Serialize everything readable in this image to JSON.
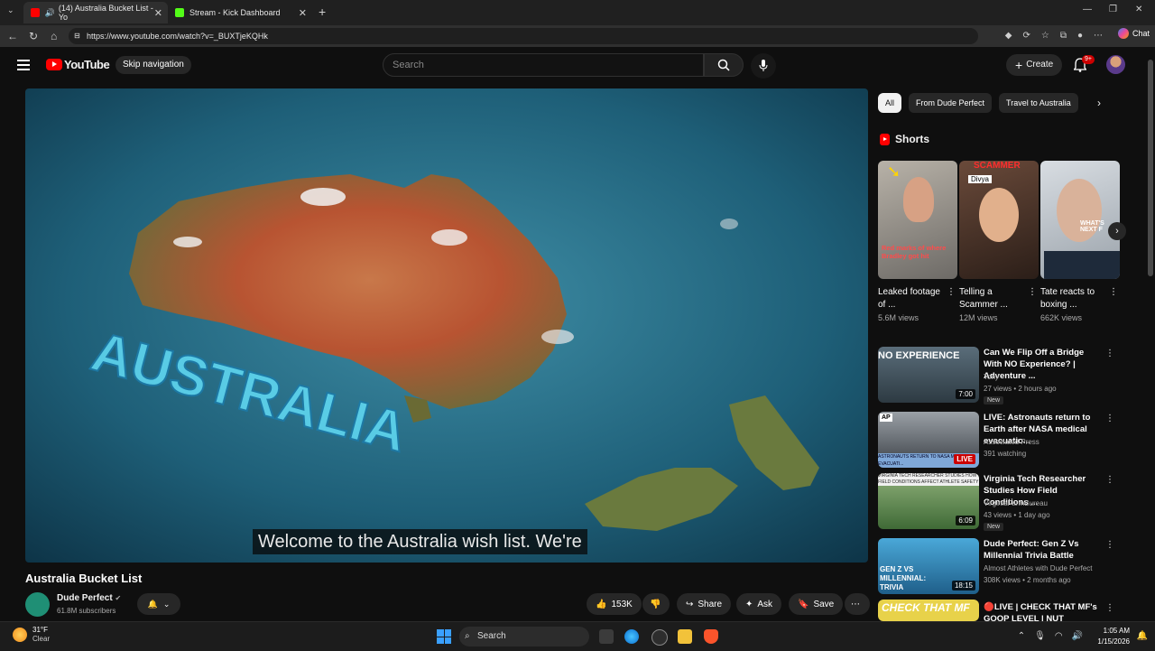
{
  "browser": {
    "tabs": [
      {
        "title": "(14) Australia Bucket List - Yo",
        "active": true
      },
      {
        "title": "Stream - Kick Dashboard",
        "active": false
      }
    ],
    "url": "https://www.youtube.com/watch?v=_BUXTjeKQHk",
    "chat_label": "Chat"
  },
  "header": {
    "logo_text": "YouTube",
    "skip_nav": "Skip navigation",
    "search_placeholder": "Search",
    "create_label": "Create",
    "notif_count": "9+"
  },
  "video": {
    "caption": "Welcome to the Australia wish list. We're",
    "overlay_text": "AUSTRALIA",
    "title": "Australia Bucket List",
    "channel": "Dude Perfect",
    "subscribers": "61.8M subscribers",
    "likes": "153K",
    "share_label": "Share",
    "ask_label": "Ask",
    "save_label": "Save"
  },
  "chips": [
    "All",
    "From Dude Perfect",
    "Travel to Australia"
  ],
  "shorts": {
    "heading": "Shorts",
    "items": [
      {
        "title": "Leaked footage of ...",
        "views": "5.6M views",
        "thumb_text": "Red marks of where Bradley got hit"
      },
      {
        "title": "Telling a Scammer ...",
        "views": "12M views",
        "thumb_text": "SCAMMER",
        "thumb_tag": "Divya"
      },
      {
        "title": "Tate reacts to boxing ...",
        "views": "662K views",
        "thumb_text": "WHAT'S NEXT F"
      }
    ]
  },
  "recommended": [
    {
      "title": "Can We Flip Off a Bridge With NO Experience? | Adventure ...",
      "channel": "Tony",
      "meta": "27 views • 2 hours ago",
      "badge": "New",
      "duration": "7:00",
      "thumb_text": "NO EXPERIENCE"
    },
    {
      "title": "LIVE: Astronauts return to Earth after NASA medical evacuatio...",
      "channel": "Associated Press",
      "meta": "391 watching",
      "badge": "",
      "duration": "LIVE",
      "thumb_text": "ASTRONAUTS RETURN TO NASA MEDICAL EVACUATI..."
    },
    {
      "title": "Virginia Tech Researcher Studies How Field Conditions ...",
      "channel": "VirginiaFarmBureau",
      "meta": "43 views • 1 day ago",
      "badge": "New",
      "duration": "6:09",
      "thumb_text": "VIRGINIA TECH RESEARCHER STUDIES HOW FIELD CONDITIONS AFFECT ATHLETE SAFETY"
    },
    {
      "title": "Dude Perfect: Gen Z Vs Millennial Trivia Battle",
      "channel": "Almost Athletes with Dude Perfect",
      "meta": "308K views • 2 months ago",
      "badge": "",
      "duration": "18:15",
      "thumb_text": "GEN Z VS MILLENNIAL: TRIVIA"
    },
    {
      "title": "🔴LIVE | CHECK THAT MF's GOOP LEVEL | NUT RAIDERS",
      "channel": "",
      "meta": "",
      "badge": "",
      "duration": "",
      "thumb_text": "CHECK THAT MF"
    }
  ],
  "taskbar": {
    "temp": "31°F",
    "condition": "Clear",
    "search_label": "Search",
    "time": "1:05 AM",
    "date": "1/15/2026"
  }
}
